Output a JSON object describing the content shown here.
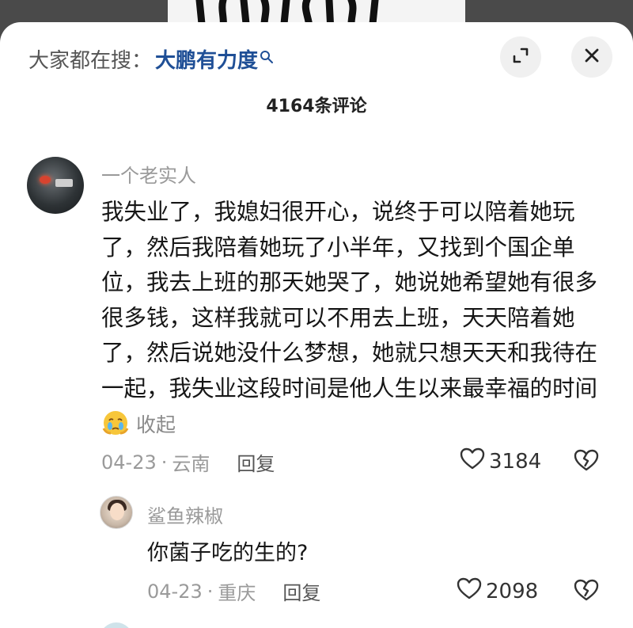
{
  "search": {
    "prefix": "大家都在搜：",
    "term": "大鹏有力度"
  },
  "header": {
    "comment_count": "4164条评论"
  },
  "comment": {
    "username": "一个老实人",
    "text": "我失业了，我媳妇很开心，说终于可以陪着她玩了，然后我陪着她玩了小半年，又找到个国企单位，我去上班的那天她哭了，她说她希望她有很多很多钱，这样我就可以不用去上班，天天陪着她了，然后说她没什么梦想，她就只想天天和我待在一起，我失业这段时间是他人生以来最幸福的时间",
    "emoji": "crying-face",
    "collapse_label": "收起",
    "date": "04-23",
    "dot": "·",
    "location": "云南",
    "reply_label": "回复",
    "likes": "3184"
  },
  "reply": {
    "username": "鲨鱼辣椒",
    "text": "你菌子吃的生的?",
    "date": "04-23",
    "dot": "·",
    "location": "重庆",
    "reply_label": "回复",
    "likes": "2098"
  },
  "colors": {
    "accent_link": "#1f4f96",
    "muted_text": "#9a9a9a",
    "body_text": "#161616",
    "button_bg": "#f0f0f0"
  },
  "icons": {
    "search": "search-icon",
    "expand": "expand-icon",
    "close": "close-icon",
    "like": "heart-icon",
    "dislike": "broken-heart-icon"
  }
}
